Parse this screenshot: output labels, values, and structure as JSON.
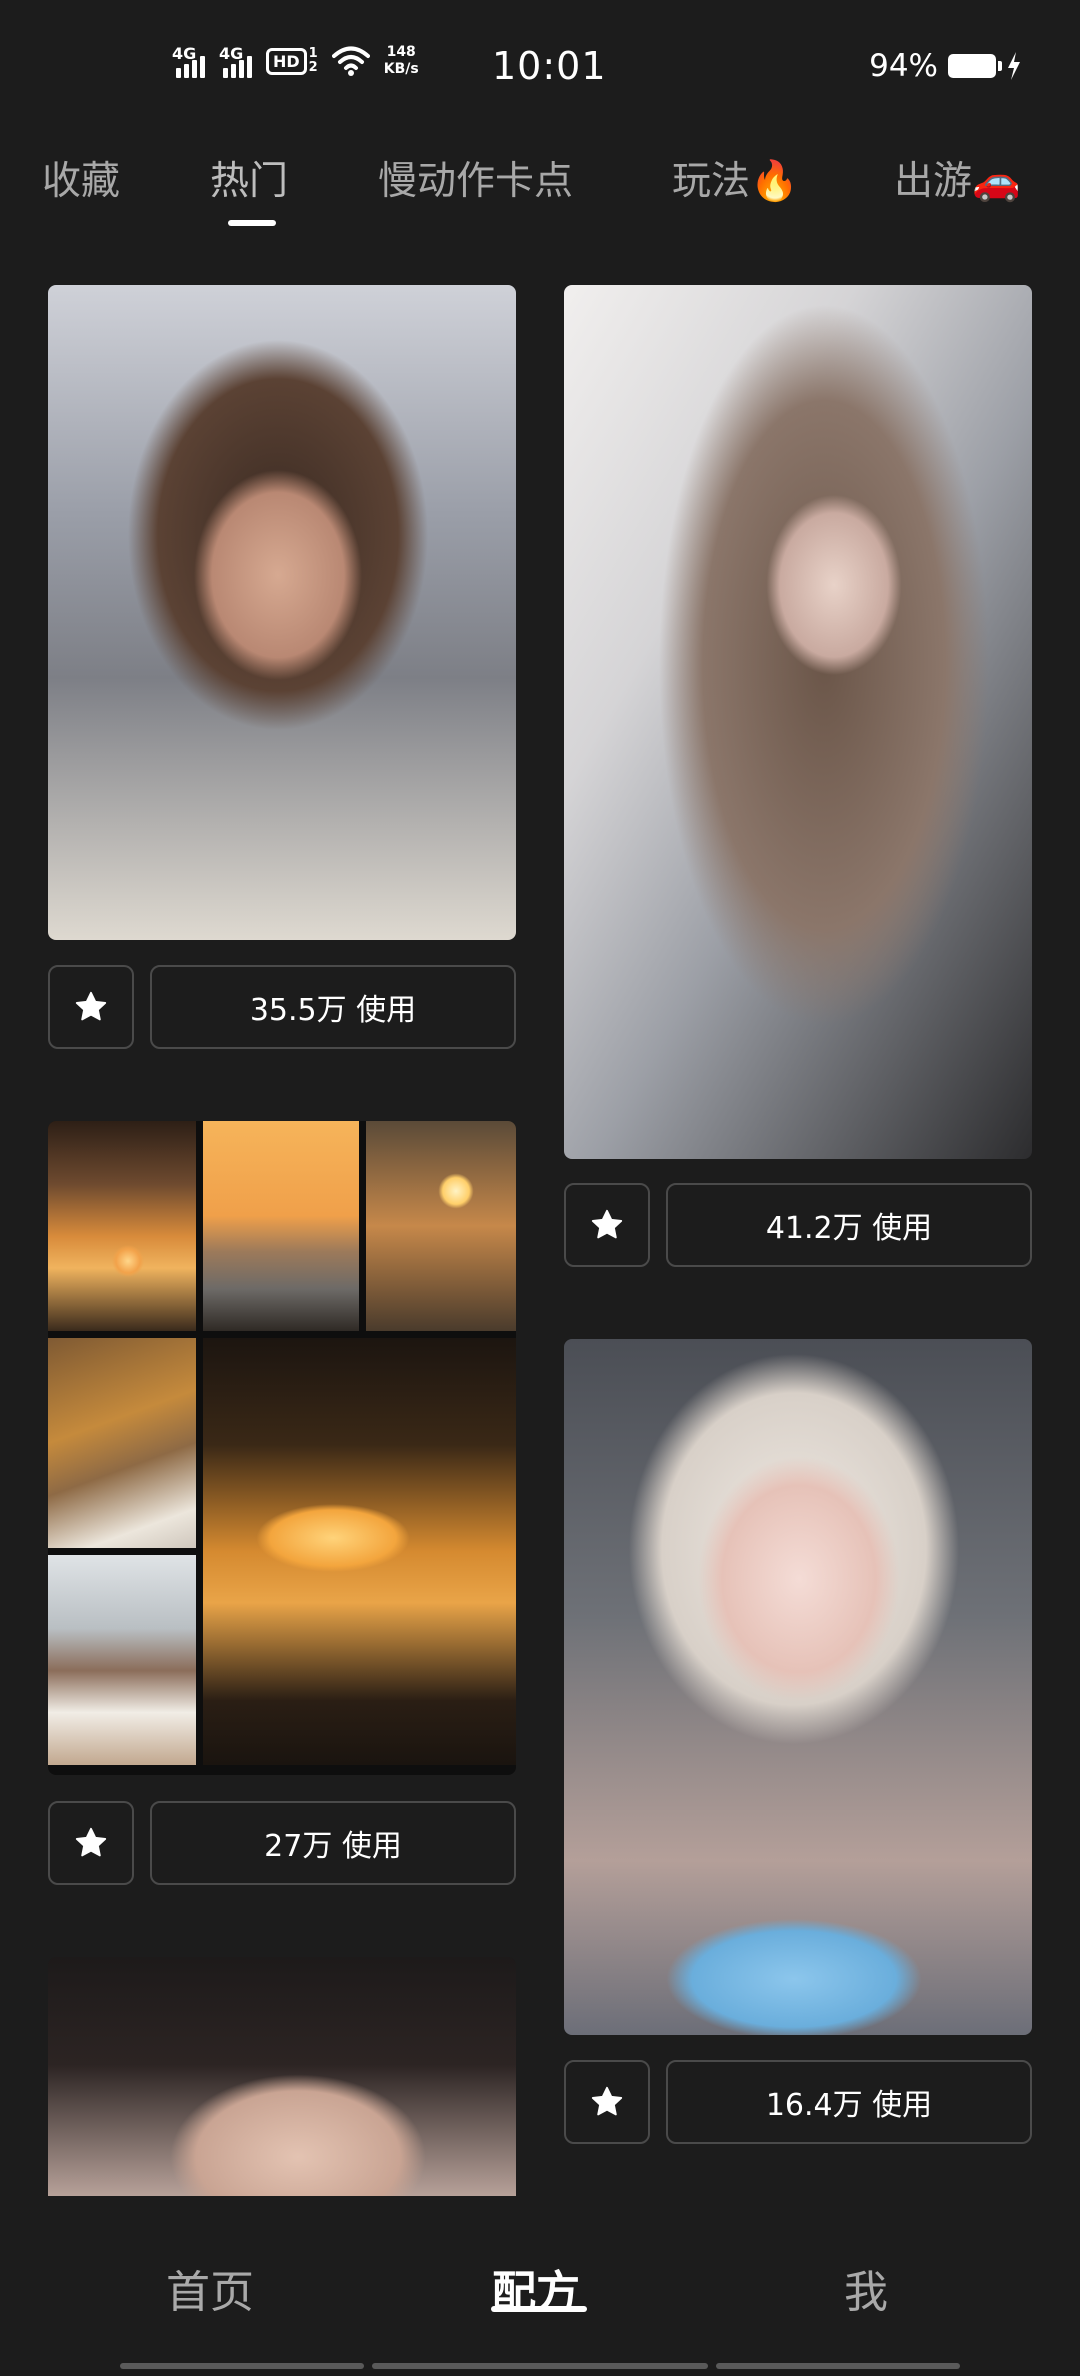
{
  "status_bar": {
    "signal_1": "4G",
    "signal_2": "4G",
    "hd_badge": "HD",
    "hd_sub_top": "1",
    "hd_sub_bottom": "2",
    "speed_value": "148",
    "speed_unit": "KB/s",
    "time": "10:01",
    "battery_percent": "94%"
  },
  "tabs": [
    {
      "label": "收藏",
      "active": false
    },
    {
      "label": "热门",
      "active": true
    },
    {
      "label": "慢动作卡点",
      "active": false
    },
    {
      "label": "玩法🔥",
      "active": false
    },
    {
      "label": "出游🚗",
      "active": false
    }
  ],
  "feed": {
    "left": [
      {
        "usage": "35.5万 使用"
      },
      {
        "usage": "27万 使用"
      },
      {
        "usage": ""
      }
    ],
    "right": [
      {
        "usage": "41.2万 使用"
      },
      {
        "usage": "16.4万 使用"
      }
    ]
  },
  "bottom_nav": [
    {
      "label": "首页",
      "active": false
    },
    {
      "label": "配方",
      "active": true
    },
    {
      "label": "我",
      "active": false
    }
  ]
}
